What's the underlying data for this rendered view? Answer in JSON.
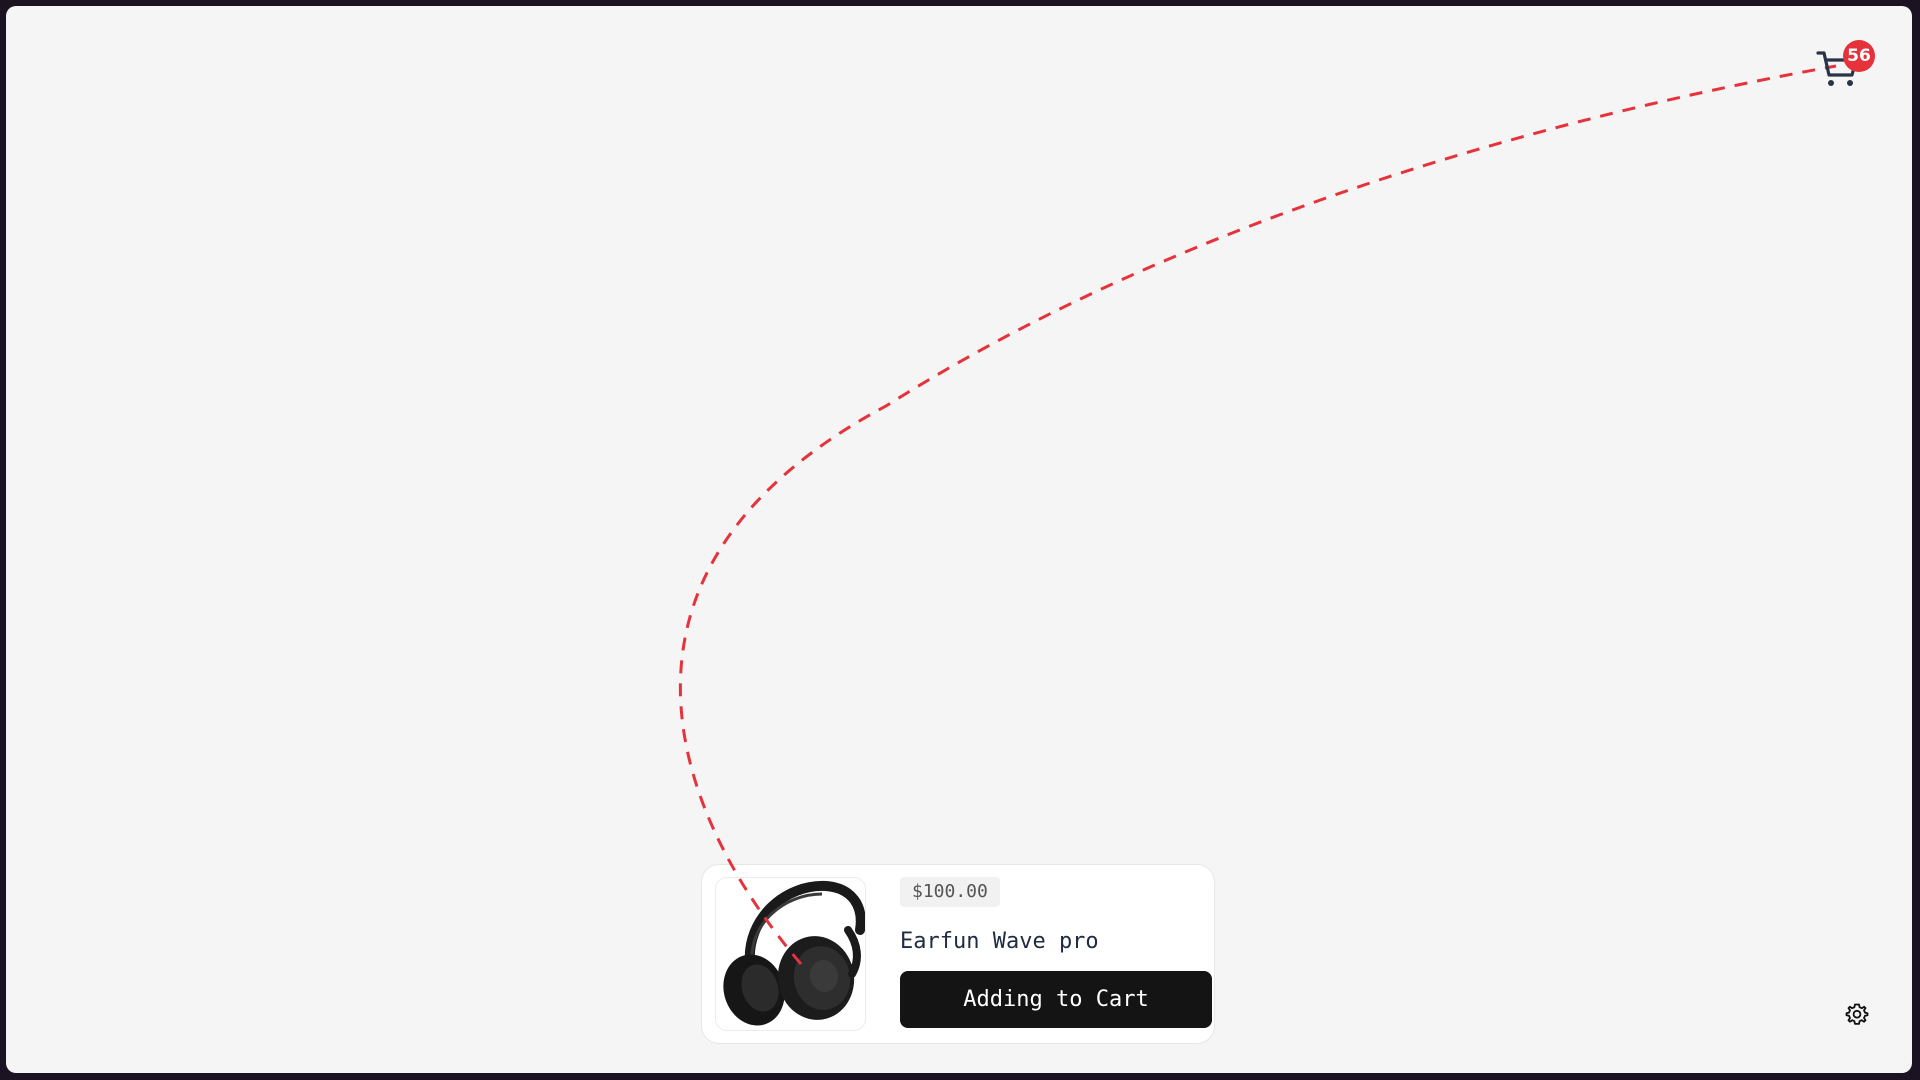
{
  "cart": {
    "icon": "shopping-cart-icon",
    "count": "56"
  },
  "product": {
    "price": "$100.00",
    "name": "Earfun Wave pro",
    "image_icon": "headphones-image",
    "button_label": "Adding to Cart"
  },
  "settings": {
    "icon": "gear-icon"
  },
  "colors": {
    "trajectory": "#e5323b",
    "badge": "#e5323b",
    "button": "#141414",
    "background": "#f5f5f5"
  }
}
